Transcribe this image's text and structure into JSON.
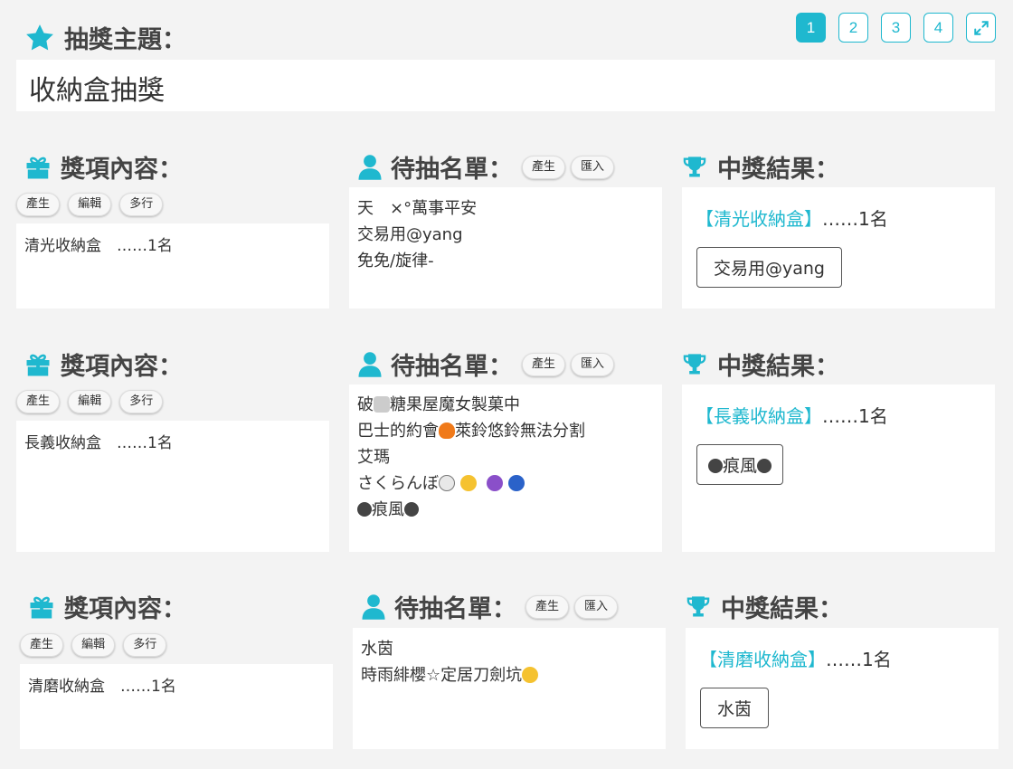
{
  "header": {
    "title_label": "抽獎主題：",
    "title_value": "收納盒抽獎",
    "pages": [
      "1",
      "2",
      "3",
      "4"
    ],
    "active_page": "1",
    "expand_icon": "expand-icon"
  },
  "sections": [
    {
      "prize_label": "獎項內容：",
      "prize_buttons": [
        "產生",
        "編輯",
        "多行"
      ],
      "prize_text": "清光收納盒　……1名",
      "list_label": "待抽名單：",
      "list_buttons": [
        "產生",
        "匯入"
      ],
      "candidates": [
        "天　×°萬事平安",
        "交易用@yang",
        "免免/旋律-"
      ],
      "result_label": "中獎結果：",
      "result_prize": "【清光收納盒】",
      "result_count": "……1名",
      "winner": "交易用@yang"
    },
    {
      "prize_label": "獎項內容：",
      "prize_buttons": [
        "產生",
        "編輯",
        "多行"
      ],
      "prize_text": "長義收納盒　……1名",
      "list_label": "待抽名單：",
      "list_buttons": [
        "產生",
        "匯入"
      ],
      "candidates_parts": {
        "c1_a": "破",
        "c1_b": "糖果屋魔女製菓中",
        "c2_a": "巴士的約會",
        "c2_b": "萊鈴悠鈴無法分割",
        "c3": "艾瑪",
        "c4": "さくらんぼ",
        "c5": "痕風"
      },
      "result_label": "中獎結果：",
      "result_prize": "【長義收納盒】",
      "result_count": "……1名",
      "winner": "痕風"
    },
    {
      "prize_label": "獎項內容：",
      "prize_buttons": [
        "產生",
        "編輯",
        "多行"
      ],
      "prize_text": "清磨收納盒　……1名",
      "list_label": "待抽名單：",
      "list_buttons": [
        "產生",
        "匯入"
      ],
      "candidates_parts": {
        "c1": "水茵",
        "c2": "時雨緋櫻☆定居刀劍坑"
      },
      "result_label": "中獎結果：",
      "result_prize": "【清磨收納盒】",
      "result_count": "……1名",
      "winner": "水茵"
    }
  ],
  "colors": {
    "accent": "#1fb8cf",
    "background": "#f3f3f3",
    "panel": "#ffffff"
  },
  "icons": [
    "star-icon",
    "gift-icon",
    "user-icon",
    "trophy-icon",
    "expand-icon"
  ]
}
